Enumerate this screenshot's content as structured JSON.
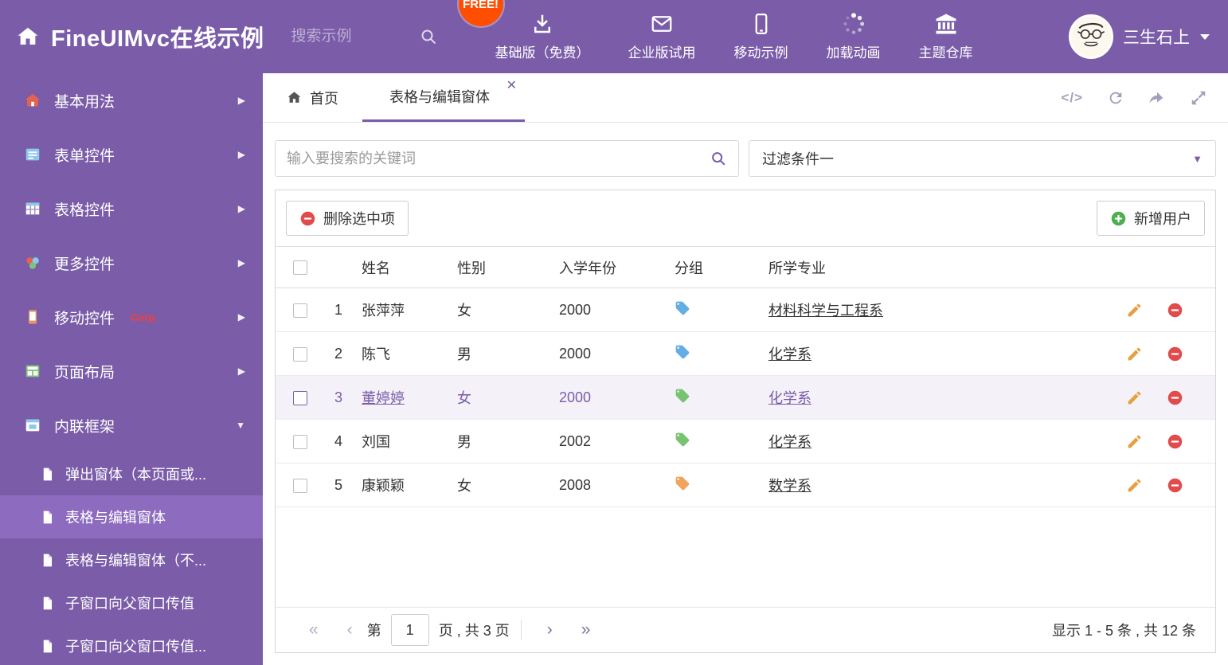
{
  "colors": {
    "purple": "#7a5ca8",
    "purple_active": "#8d6cc0",
    "free_badge": "#ff4e00",
    "corp_red": "#ff3b30",
    "delete_red": "#e14b4b",
    "add_green": "#4cae4c",
    "pencil_orange": "#e3a242"
  },
  "header": {
    "title": "FineUIMvc在线示例",
    "search_placeholder": "搜索示例",
    "free_badge": "FREE!",
    "nav": [
      {
        "label": "基础版（免费）",
        "icon": "download-icon"
      },
      {
        "label": "企业版试用",
        "icon": "envelope-icon"
      },
      {
        "label": "移动示例",
        "icon": "mobile-icon"
      },
      {
        "label": "加载动画",
        "icon": "spinner-icon"
      },
      {
        "label": "主题仓库",
        "icon": "bank-icon"
      }
    ],
    "username": "三生石上"
  },
  "sidebar": {
    "items": [
      {
        "label": "基本用法"
      },
      {
        "label": "表单控件"
      },
      {
        "label": "表格控件"
      },
      {
        "label": "更多控件"
      },
      {
        "label": "移动控件",
        "badge": "Corp."
      },
      {
        "label": "页面布局"
      },
      {
        "label": "内联框架",
        "expanded": true
      }
    ],
    "subitems": [
      {
        "label": "弹出窗体（本页面或..."
      },
      {
        "label": "表格与编辑窗体",
        "active": true
      },
      {
        "label": "表格与编辑窗体（不..."
      },
      {
        "label": "子窗口向父窗口传值"
      },
      {
        "label": "子窗口向父窗口传值..."
      }
    ]
  },
  "tabs": {
    "home": "首页",
    "active": "表格与编辑窗体"
  },
  "filter": {
    "search_placeholder": "输入要搜索的关键词",
    "dropdown_value": "过滤条件一"
  },
  "toolbar": {
    "delete_label": "删除选中项",
    "add_label": "新增用户"
  },
  "table": {
    "headers": {
      "name": "姓名",
      "gender": "性别",
      "year": "入学年份",
      "group": "分组",
      "major": "所学专业"
    },
    "rows": [
      {
        "num": "1",
        "name": "张萍萍",
        "gender": "女",
        "year": "2000",
        "tag_color": "#64aee4",
        "major": "材料科学与工程系"
      },
      {
        "num": "2",
        "name": "陈飞",
        "gender": "男",
        "year": "2000",
        "tag_color": "#64aee4",
        "major": "化学系"
      },
      {
        "num": "3",
        "name": "董婷婷",
        "gender": "女",
        "year": "2000",
        "tag_color": "#77c372",
        "major": "化学系",
        "selected": true
      },
      {
        "num": "4",
        "name": "刘国",
        "gender": "男",
        "year": "2002",
        "tag_color": "#77c372",
        "major": "化学系"
      },
      {
        "num": "5",
        "name": "康颖颖",
        "gender": "女",
        "year": "2008",
        "tag_color": "#f0a45c",
        "major": "数学系"
      }
    ]
  },
  "pagination": {
    "prefix": "第",
    "page": "1",
    "suffix": "页 , 共 3 页",
    "summary": "显示 1 - 5 条 , 共 12 条"
  }
}
